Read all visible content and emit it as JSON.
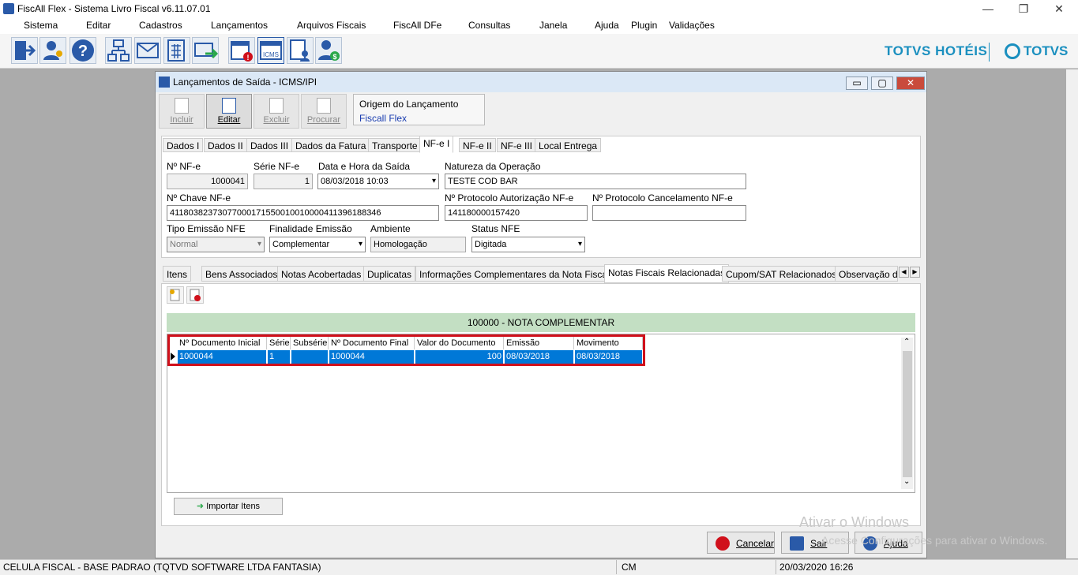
{
  "app": {
    "title": "FiscAll Flex - Sistema Livro Fiscal v6.11.07.01",
    "window_controls": [
      "—",
      "❐",
      "✕"
    ]
  },
  "menu": [
    "Sistema",
    "Editar",
    "Cadastros",
    "Lançamentos",
    "Arquivos Fiscais",
    "FiscAll DFe",
    "Consultas",
    "Janela",
    "Ajuda",
    "Plugin",
    "Validações"
  ],
  "brand": {
    "left": "TOTVS HOTÉIS",
    "right": "TOTVS",
    "color": "#1a8fbf"
  },
  "dialog": {
    "title": "Lançamentos de Saída - ICMS/IPI",
    "controls": [
      "▭",
      "▢",
      "✕"
    ],
    "actions": [
      {
        "label": "Incluir",
        "enabled": false
      },
      {
        "label": "Editar",
        "enabled": true
      },
      {
        "label": "Excluir",
        "enabled": false
      },
      {
        "label": "Procurar",
        "enabled": false
      }
    ],
    "origem": {
      "title": "Origem do Lançamento",
      "value": "Fiscall Flex"
    },
    "tabs": [
      "Dados I",
      "Dados II",
      "Dados III",
      "Dados da Fatura",
      "Transporte",
      "NF-e I",
      "NF-e II",
      "NF-e III",
      "Local Entrega"
    ],
    "active_tab": "NF-e I",
    "form": {
      "nf_label": "Nº NF-e",
      "nf_value": "1000041",
      "serie_label": "Série NF-e",
      "serie_value": "1",
      "data_label": "Data e Hora da Saída",
      "data_value": "08/03/2018 10:03",
      "natureza_label": "Natureza da Operação",
      "natureza_value": "TESTE COD BAR",
      "chave_label": "Nº Chave NF-e",
      "chave_value": "41180382373077000171550010010000411396188346",
      "prot_aut_label": "Nº Protocolo Autorização NF-e",
      "prot_aut_value": "141180000157420",
      "prot_canc_label": "Nº Protocolo Cancelamento NF-e",
      "prot_canc_value": "",
      "tipo_label": "Tipo Emissão NFE",
      "tipo_value": "Normal",
      "finalidade_label": "Finalidade Emissão",
      "finalidade_value": "Complementar",
      "ambiente_label": "Ambiente",
      "ambiente_value": "Homologação",
      "status_label": "Status NFE",
      "status_value": "Digitada"
    },
    "subtabs": [
      "Itens",
      "Bens Associados",
      "Notas Acobertadas",
      "Duplicatas",
      "Informações Complementares da Nota Fiscal",
      "Notas Fiscais Relacionadas",
      "Cupom/SAT Relacionados",
      "Observação d"
    ],
    "active_subtab": "Notas Fiscais Relacionadas",
    "group_header": "100000   -   NOTA COMPLEMENTAR",
    "grid": {
      "columns": [
        "Nº Documento Inicial",
        "Série",
        "Subsérie",
        "Nº Documento Final",
        "Valor do Documento",
        "Emissão",
        "Movimento"
      ],
      "rows": [
        [
          "1000044",
          "1",
          "",
          "1000044",
          "100",
          "08/03/2018",
          "08/03/2018"
        ]
      ]
    },
    "import_button": "Importar Itens",
    "bottom_buttons": [
      {
        "label": "Cancelar",
        "icon": "cancel-icon"
      },
      {
        "label": "Sair",
        "icon": "exit-icon"
      },
      {
        "label": "Ajuda",
        "icon": "help-icon"
      }
    ]
  },
  "watermark": {
    "line1": "Ativar o Windows",
    "line2": "Acesse Configurações para ativar o Windows."
  },
  "status": {
    "left": "CELULA FISCAL - BASE PADRAO (TQTVD SOFTWARE LTDA FANTASIA)",
    "mid": "CM",
    "right": "20/03/2020 16:26"
  }
}
